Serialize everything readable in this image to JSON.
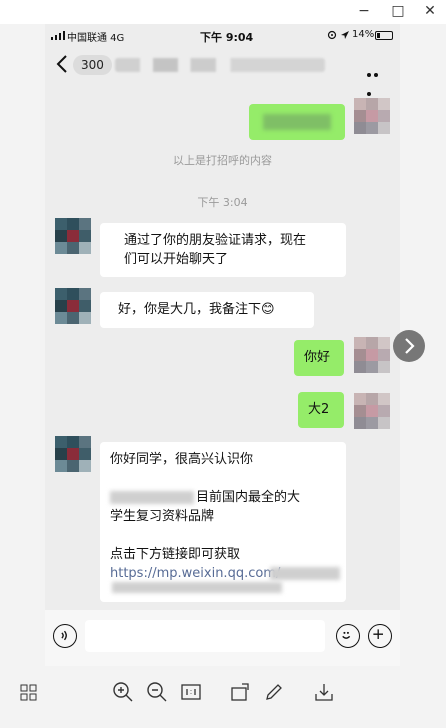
{
  "window": {
    "minimize": "−",
    "maximize": "□",
    "close": "✕"
  },
  "status_bar": {
    "carrier": "中国联通 4G",
    "time": "下午 9:04",
    "battery": "14%"
  },
  "nav": {
    "unread_count": "300"
  },
  "chat": {
    "system_note": "以上是打招呼的内容",
    "timestamp": "下午 3:04",
    "messages": [
      {
        "from": "contact",
        "lines": [
          "通过了你的朋友验证请求，现在",
          "们可以开始聊天了"
        ]
      },
      {
        "from": "contact",
        "text": "好，你是大几，我备注下😊"
      },
      {
        "from": "me",
        "text": "你好"
      },
      {
        "from": "me",
        "text": "大2"
      },
      {
        "from": "contact",
        "greeting": "你好同学，很高兴认识你",
        "line2": "目前国内最全的大",
        "line3": "学生复习资料品牌",
        "cta": "点击下方链接即可获取",
        "link": "https://mp.weixin.qq.com/"
      }
    ]
  },
  "icons": {
    "back": "chevron-left-icon",
    "more": "more-dots-icon",
    "forward": "forward-arrow-icon",
    "voice": "voice-icon",
    "emoji": "emoji-icon",
    "plus": "plus-icon"
  },
  "colors": {
    "outgoing_bubble": "#95ec69",
    "incoming_bubble": "#ffffff",
    "chat_bg": "#ededed"
  }
}
